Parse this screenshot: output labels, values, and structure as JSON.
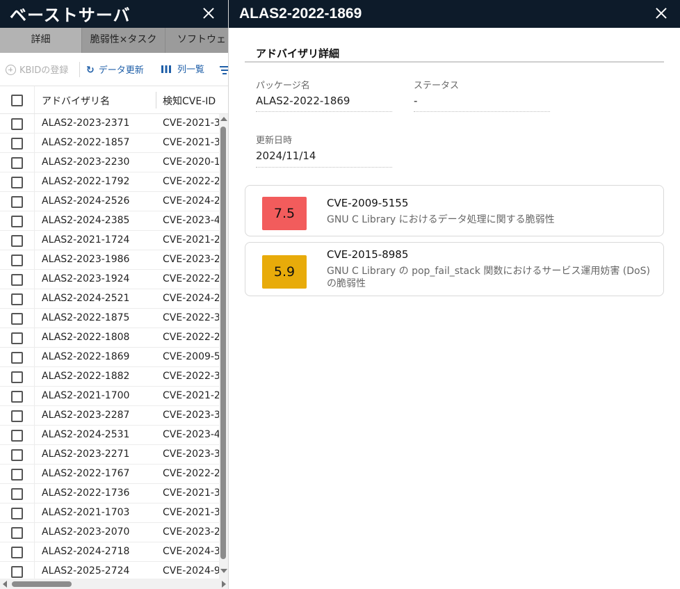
{
  "left_panel": {
    "title": "ベーストサーバ",
    "tabs": [
      "詳細",
      "脆弱性×タスク",
      "ソフトウェ"
    ],
    "toolbar": {
      "register_kbid": "KBIDの登録",
      "refresh": "データ更新",
      "columns": "列一覧"
    },
    "table": {
      "headers": [
        "アドバイザリ名",
        "検知CVE-ID"
      ],
      "rows": [
        {
          "name": "ALAS2-2023-2371",
          "cve": "CVE-2021-3"
        },
        {
          "name": "ALAS2-2022-1857",
          "cve": "CVE-2021-3"
        },
        {
          "name": "ALAS2-2023-2230",
          "cve": "CVE-2020-1"
        },
        {
          "name": "ALAS2-2022-1792",
          "cve": "CVE-2022-2"
        },
        {
          "name": "ALAS2-2024-2526",
          "cve": "CVE-2024-2"
        },
        {
          "name": "ALAS2-2024-2385",
          "cve": "CVE-2023-4"
        },
        {
          "name": "ALAS2-2021-1724",
          "cve": "CVE-2021-2"
        },
        {
          "name": "ALAS2-2023-1986",
          "cve": "CVE-2023-2"
        },
        {
          "name": "ALAS2-2023-1924",
          "cve": "CVE-2022-2"
        },
        {
          "name": "ALAS2-2024-2521",
          "cve": "CVE-2024-2"
        },
        {
          "name": "ALAS2-2022-1875",
          "cve": "CVE-2022-3"
        },
        {
          "name": "ALAS2-2022-1808",
          "cve": "CVE-2022-2"
        },
        {
          "name": "ALAS2-2022-1869",
          "cve": "CVE-2009-5"
        },
        {
          "name": "ALAS2-2022-1882",
          "cve": "CVE-2022-3"
        },
        {
          "name": "ALAS2-2021-1700",
          "cve": "CVE-2021-2"
        },
        {
          "name": "ALAS2-2023-2287",
          "cve": "CVE-2023-3"
        },
        {
          "name": "ALAS2-2024-2531",
          "cve": "CVE-2023-4"
        },
        {
          "name": "ALAS2-2023-2271",
          "cve": "CVE-2023-3"
        },
        {
          "name": "ALAS2-2022-1767",
          "cve": "CVE-2022-2"
        },
        {
          "name": "ALAS2-2022-1736",
          "cve": "CVE-2021-3"
        },
        {
          "name": "ALAS2-2021-1703",
          "cve": "CVE-2021-3"
        },
        {
          "name": "ALAS2-2023-2070",
          "cve": "CVE-2023-2"
        },
        {
          "name": "ALAS2-2024-2718",
          "cve": "CVE-2024-3"
        },
        {
          "name": "ALAS2-2025-2724",
          "cve": "CVE-2024-9"
        }
      ]
    }
  },
  "right_panel": {
    "title": "ALAS2-2022-1869",
    "section_title": "アドバイザリ詳細",
    "fields": {
      "package_label": "パッケージ名",
      "package_value": "ALAS2-2022-1869",
      "status_label": "ステータス",
      "status_value": "-",
      "updated_label": "更新日時",
      "updated_value": "2024/11/14"
    },
    "cves": [
      {
        "score": "7.5",
        "id": "CVE-2009-5155",
        "description": "GNU C Library におけるデータ処理に関する脆弱性",
        "color": "#f25c5c"
      },
      {
        "score": "5.9",
        "id": "CVE-2015-8985",
        "description": "GNU C Library の pop_fail_stack 関数におけるサービス運用妨害 (DoS) の脆弱性",
        "color": "#e8ab0a"
      }
    ]
  },
  "colors": {
    "header_bg": "#0d1b2a",
    "accent": "#1f5fa8",
    "tab_bg": "#9b9b9b",
    "tab_active_bg": "#b3b3b3"
  }
}
